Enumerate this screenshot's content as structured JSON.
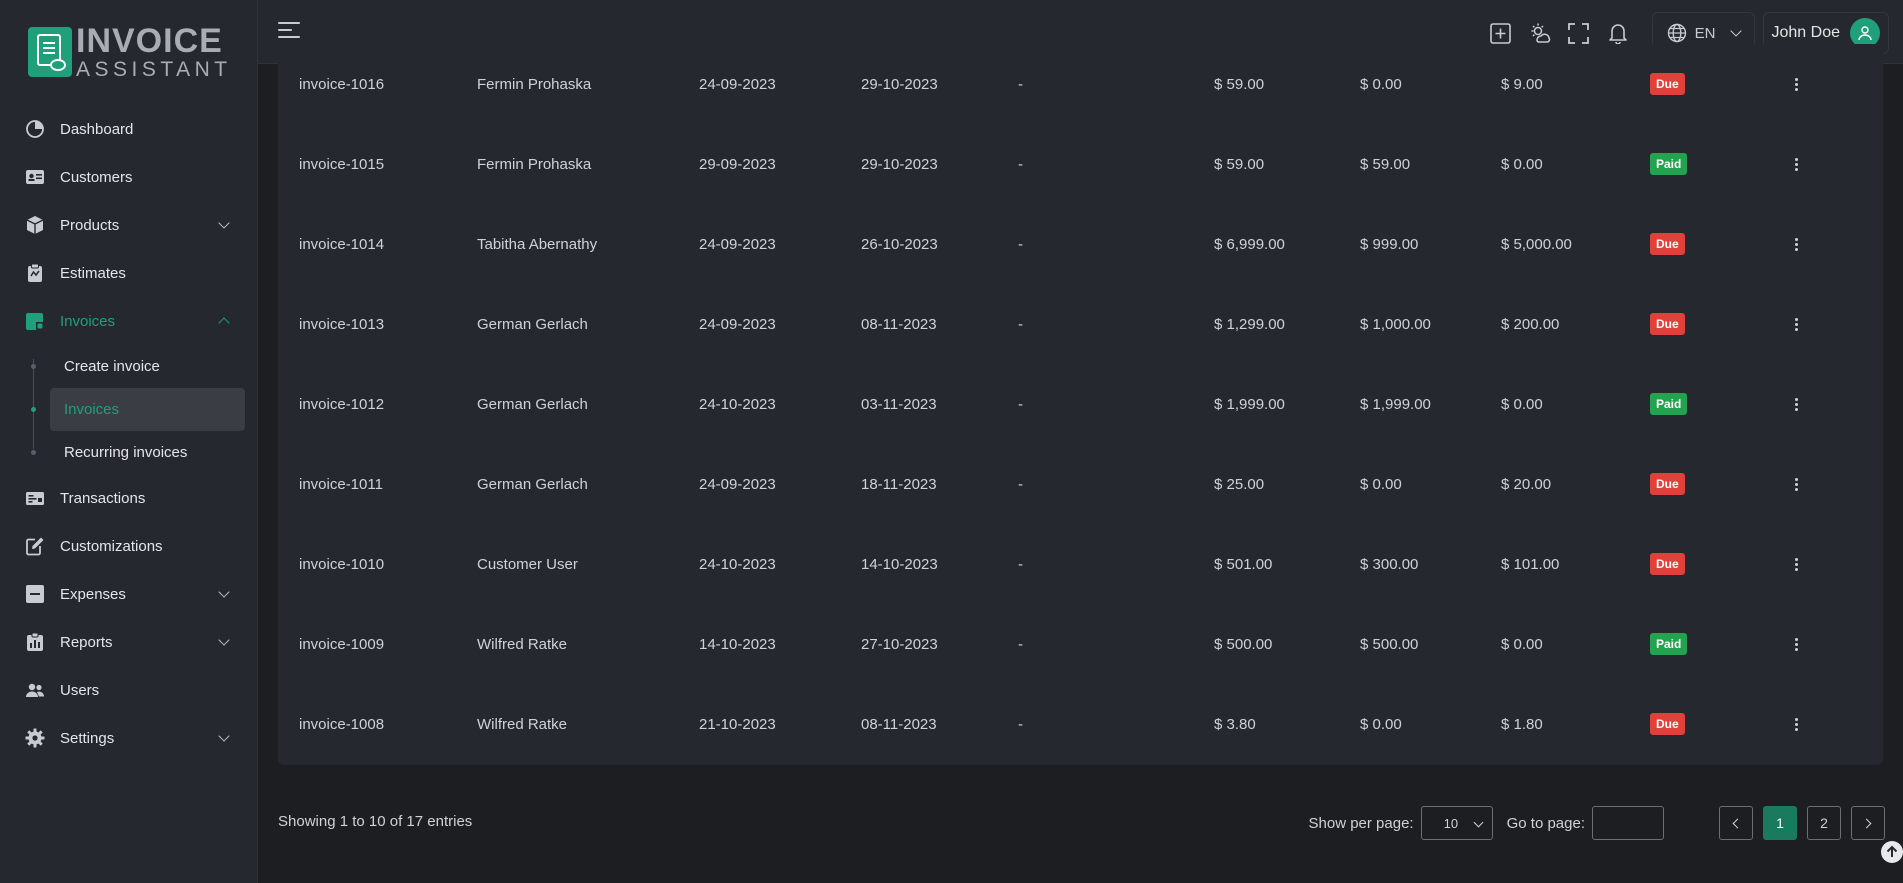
{
  "brand": {
    "line1": "INVOICE",
    "line2": "ASSISTANT"
  },
  "sidebar": {
    "items": [
      {
        "label": "Dashboard",
        "icon": "pie-chart-icon"
      },
      {
        "label": "Customers",
        "icon": "id-card-icon"
      },
      {
        "label": "Products",
        "icon": "box-icon",
        "expandable": true
      },
      {
        "label": "Estimates",
        "icon": "clipboard-icon"
      },
      {
        "label": "Invoices",
        "icon": "invoice-icon",
        "expandable": true,
        "expanded": true
      },
      {
        "label": "Transactions",
        "icon": "receipt-icon"
      },
      {
        "label": "Customizations",
        "icon": "edit-icon"
      },
      {
        "label": "Expenses",
        "icon": "minus-square-icon",
        "expandable": true
      },
      {
        "label": "Reports",
        "icon": "report-icon",
        "expandable": true
      },
      {
        "label": "Users",
        "icon": "users-icon"
      },
      {
        "label": "Settings",
        "icon": "gear-icon",
        "expandable": true
      }
    ],
    "invoices_sub": [
      {
        "label": "Create invoice"
      },
      {
        "label": "Invoices",
        "active": true
      },
      {
        "label": "Recurring invoices"
      }
    ]
  },
  "topbar": {
    "language": "EN",
    "user_name": "John Doe"
  },
  "invoices": [
    {
      "id": "invoice-1016",
      "customer": "Fermin Prohaska",
      "date": "24-09-2023",
      "due_date": "29-10-2023",
      "ref": "-",
      "total": "$ 59.00",
      "paid": "$ 0.00",
      "due": "$ 9.00",
      "status": "Due"
    },
    {
      "id": "invoice-1015",
      "customer": "Fermin Prohaska",
      "date": "29-09-2023",
      "due_date": "29-10-2023",
      "ref": "-",
      "total": "$ 59.00",
      "paid": "$ 59.00",
      "due": "$ 0.00",
      "status": "Paid"
    },
    {
      "id": "invoice-1014",
      "customer": "Tabitha Abernathy",
      "date": "24-09-2023",
      "due_date": "26-10-2023",
      "ref": "-",
      "total": "$ 6,999.00",
      "paid": "$ 999.00",
      "due": "$ 5,000.00",
      "status": "Due"
    },
    {
      "id": "invoice-1013",
      "customer": "German Gerlach",
      "date": "24-09-2023",
      "due_date": "08-11-2023",
      "ref": "-",
      "total": "$ 1,299.00",
      "paid": "$ 1,000.00",
      "due": "$ 200.00",
      "status": "Due"
    },
    {
      "id": "invoice-1012",
      "customer": "German Gerlach",
      "date": "24-10-2023",
      "due_date": "03-11-2023",
      "ref": "-",
      "total": "$ 1,999.00",
      "paid": "$ 1,999.00",
      "due": "$ 0.00",
      "status": "Paid"
    },
    {
      "id": "invoice-1011",
      "customer": "German Gerlach",
      "date": "24-09-2023",
      "due_date": "18-11-2023",
      "ref": "-",
      "total": "$ 25.00",
      "paid": "$ 0.00",
      "due": "$ 20.00",
      "status": "Due"
    },
    {
      "id": "invoice-1010",
      "customer": "Customer User",
      "date": "24-10-2023",
      "due_date": "14-10-2023",
      "ref": "-",
      "total": "$ 501.00",
      "paid": "$ 300.00",
      "due": "$ 101.00",
      "status": "Due"
    },
    {
      "id": "invoice-1009",
      "customer": "Wilfred Ratke",
      "date": "14-10-2023",
      "due_date": "27-10-2023",
      "ref": "-",
      "total": "$ 500.00",
      "paid": "$ 500.00",
      "due": "$ 0.00",
      "status": "Paid"
    },
    {
      "id": "invoice-1008",
      "customer": "Wilfred Ratke",
      "date": "21-10-2023",
      "due_date": "08-11-2023",
      "ref": "-",
      "total": "$ 3.80",
      "paid": "$ 0.00",
      "due": "$ 1.80",
      "status": "Due"
    }
  ],
  "footer": {
    "showing": "Showing 1 to 10 of 17 entries",
    "per_page_label": "Show per page:",
    "per_page_value": "10",
    "goto_label": "Go to page:",
    "goto_value": "",
    "pages": [
      "1",
      "2"
    ],
    "current_page": "1"
  },
  "colors": {
    "accent": "#1fa07a",
    "due": "#e0413a",
    "paid": "#23a34f"
  }
}
